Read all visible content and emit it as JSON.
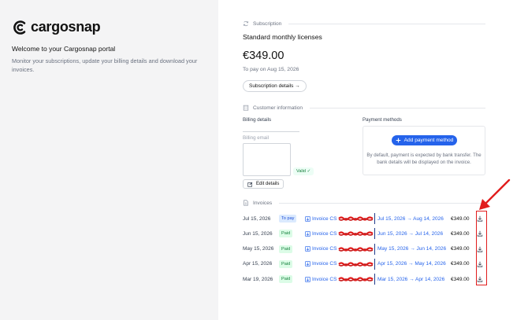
{
  "brand": {
    "name": "cargosnap",
    "welcome": "Welcome to your Cargosnap portal",
    "description": "Monitor your subscriptions, update your billing details and download your invoices."
  },
  "subscription": {
    "section_title": "Subscription",
    "plan": "Standard monthly licenses",
    "amount": "€349.00",
    "due": "To pay on Aug 15, 2026",
    "details_button": "Subscription details →"
  },
  "customer": {
    "section_title": "Customer information",
    "billing_details_label": "Billing details",
    "billing_email_label": "Billing email",
    "valid_label": "Valid ✓",
    "edit_button": "Edit details",
    "payment_methods_label": "Payment methods",
    "add_payment_button": "Add payment method",
    "payment_note": "By default, payment is expected by bank transfer. The bank details will be displayed on the invoice."
  },
  "invoices": {
    "section_title": "Invoices",
    "rows": [
      {
        "date": "Jul 15, 2026",
        "status": "To pay",
        "status_kind": "topay",
        "name": "Invoice CS",
        "period": "Jul 15, 2026 → Aug 14, 2026",
        "amount": "€349.00"
      },
      {
        "date": "Jun 15, 2026",
        "status": "Paid",
        "status_kind": "paid",
        "name": "Invoice CS",
        "period": "Jun 15, 2026 → Jul 14, 2026",
        "amount": "€349.00"
      },
      {
        "date": "May 15, 2026",
        "status": "Paid",
        "status_kind": "paid",
        "name": "Invoice CS",
        "period": "May 15, 2026 → Jun 14, 2026",
        "amount": "€349.00"
      },
      {
        "date": "Apr 15, 2026",
        "status": "Paid",
        "status_kind": "paid",
        "name": "Invoice CS",
        "period": "Apr 15, 2026 → May 14, 2026",
        "amount": "€349.00"
      },
      {
        "date": "Mar 19, 2026",
        "status": "Paid",
        "status_kind": "paid",
        "name": "Invoice CS",
        "period": "Mar 15, 2026 → Apr 14, 2026",
        "amount": "€349.00"
      }
    ]
  },
  "colors": {
    "accent": "#2563eb",
    "paid": "#15803d",
    "annotation": "#e11d1d"
  }
}
